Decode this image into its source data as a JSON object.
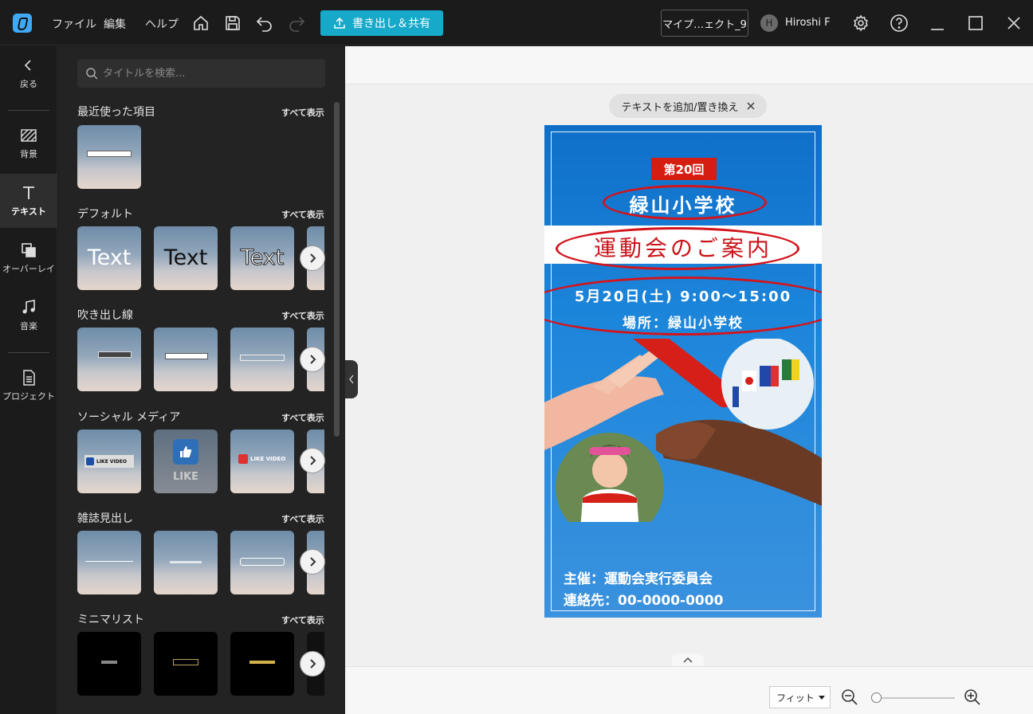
{
  "app": {
    "menu": [
      "ファイル",
      "編集",
      "ヘルプ"
    ],
    "export_label": "書き出し＆共有",
    "project_label": "マイプ…ェクト_9",
    "user_initial": "H",
    "user_name": "Hiroshi F",
    "accent_color": "#17a9c9"
  },
  "nav": {
    "back": "戻る",
    "items": [
      {
        "label": "背景",
        "icon": "background-icon"
      },
      {
        "label": "テキスト",
        "icon": "text-icon",
        "active": true
      },
      {
        "label": "オーバーレイ",
        "icon": "overlay-icon"
      },
      {
        "label": "音楽",
        "icon": "music-icon"
      },
      {
        "label": "プロジェクト",
        "icon": "project-icon"
      }
    ]
  },
  "panel": {
    "search_placeholder": "タイトルを検索...",
    "show_all": "すべて表示",
    "sections": [
      {
        "title": "最近使った項目"
      },
      {
        "title": "デフォルト",
        "thumb_text": "Text"
      },
      {
        "title": "吹き出し線"
      },
      {
        "title": "ソーシャル メディア",
        "badges": [
          "LIKE VIDEO",
          "LIKE",
          "LIKE VIDEO"
        ]
      },
      {
        "title": "雑誌見出し"
      },
      {
        "title": "ミニマリスト"
      }
    ]
  },
  "stage": {
    "hint": "テキストを追加/置き換え",
    "zoom_mode": "フィット",
    "zoom_level": 0.02
  },
  "poster": {
    "edition": "第20回",
    "school": "緑山小学校",
    "headline": "運動会のご案内",
    "date": "5月20日(土) 9:00～15:00",
    "place": "場所：緑山小学校",
    "organizer": "主催：運動会実行委員会",
    "contact": "連絡先：00-0000-0000",
    "colors": {
      "background": "#1c86db",
      "badge": "#d51d12",
      "headline": "#c8141a",
      "annotation": "#d3141c"
    }
  }
}
